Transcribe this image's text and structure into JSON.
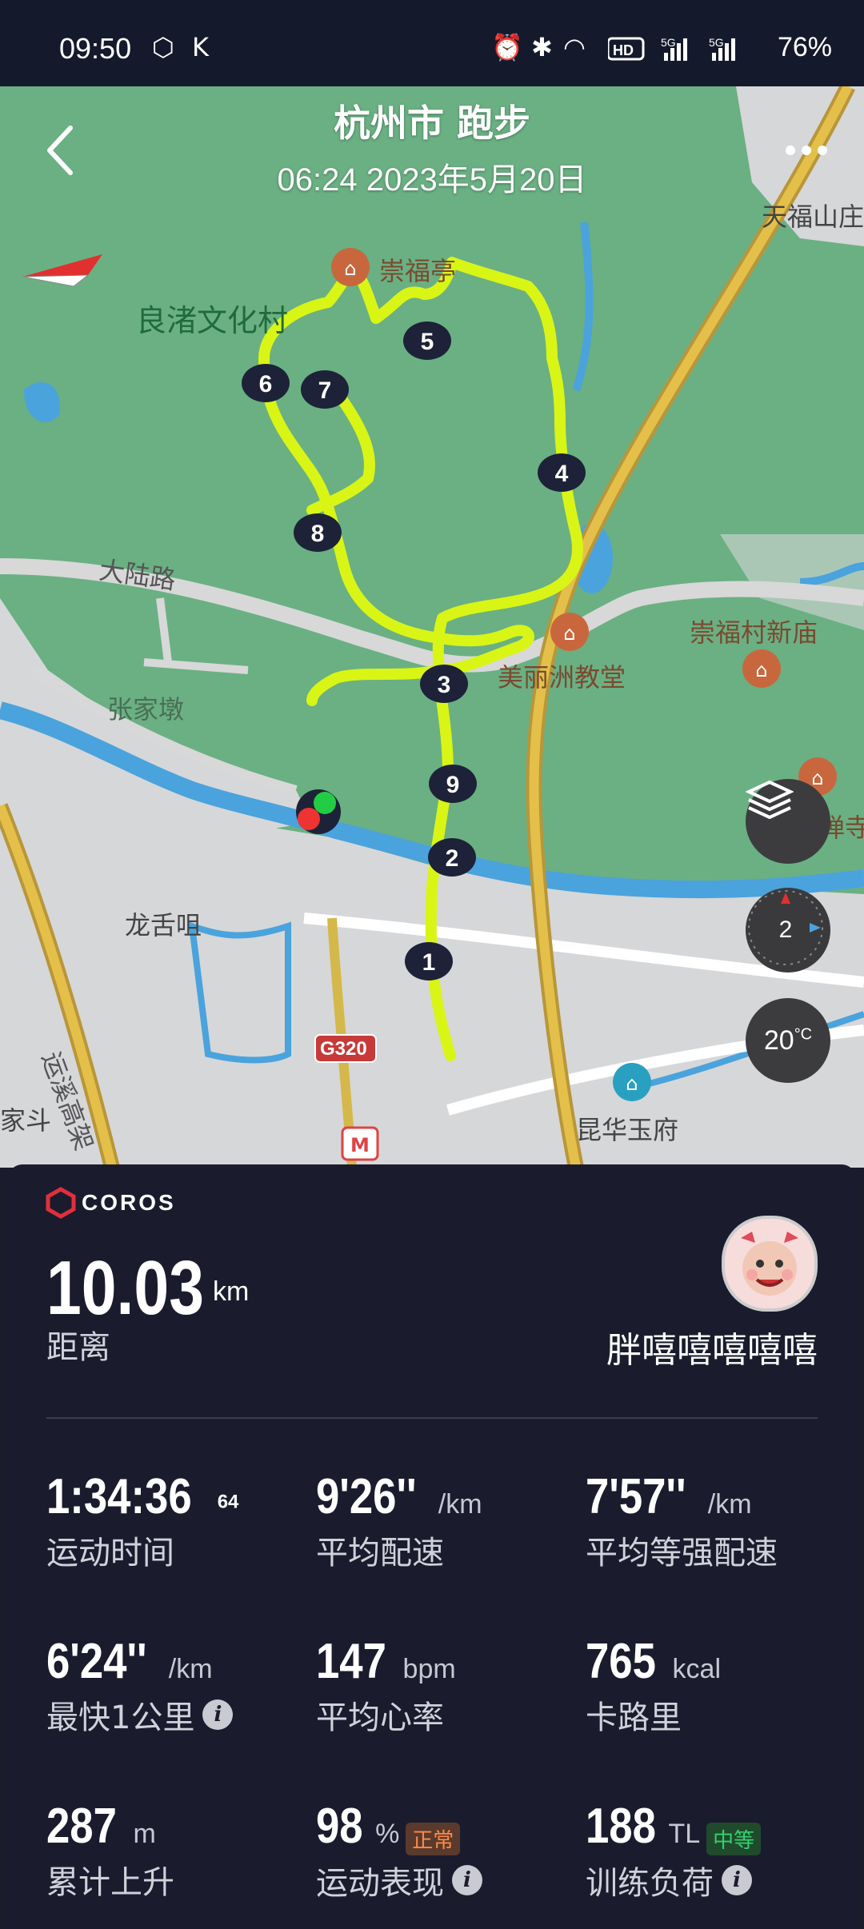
{
  "status_bar": {
    "time": "09:50",
    "battery": "76%"
  },
  "header": {
    "title": "杭州市 跑步",
    "subtitle": "06:24 2023年5月20日"
  },
  "map": {
    "places": {
      "tianfu": "天福山庄",
      "chongfuting": "崇福亭",
      "liangzhu": "良渚文化村",
      "daluroad": "大陆路",
      "zhangjiadun": "张家墩",
      "chongfucun": "崇福村新庙",
      "meilizhou": "美丽洲教堂",
      "chansi": "禅寺",
      "longshe": "龙舌咀",
      "yunxi": "运溪高架",
      "g320": "G320",
      "kunhua": "昆华玉府",
      "jiadou": "家斗"
    },
    "markers": [
      "1",
      "2",
      "3",
      "4",
      "5",
      "6",
      "7",
      "8",
      "9"
    ],
    "compass_value": "2",
    "temperature": "20",
    "temperature_unit": "°C",
    "colors": {
      "route": "#d9f516",
      "land": "#6ab083",
      "water": "#4aa3dc",
      "urban": "#d6d7d9",
      "highway": "#d4a832"
    }
  },
  "panel": {
    "brand": "COROS",
    "distance_value": "10.03",
    "distance_unit": "km",
    "distance_label": "距离",
    "username": "胖嘻嘻嘻嘻嘻",
    "stats": {
      "time": {
        "value": "1:34:36",
        "sup": "64",
        "label": "运动时间"
      },
      "avg_pace": {
        "value": "9'26''",
        "unit": "/km",
        "label": "平均配速"
      },
      "avg_grade_pace": {
        "value": "7'57''",
        "unit": "/km",
        "label": "平均等强配速"
      },
      "fastest_km": {
        "value": "6'24''",
        "unit": "/km",
        "label": "最快1公里"
      },
      "avg_hr": {
        "value": "147",
        "unit": "bpm",
        "label": "平均心率"
      },
      "calories": {
        "value": "765",
        "unit": "kcal",
        "label": "卡路里"
      },
      "ascent": {
        "value": "287",
        "unit": "m",
        "label": "累计上升"
      },
      "performance": {
        "value": "98",
        "unit": "%",
        "tag": "正常",
        "label": "运动表现"
      },
      "training_load": {
        "value": "188",
        "unit": "TL",
        "tag": "中等",
        "label": "训练负荷"
      }
    }
  }
}
